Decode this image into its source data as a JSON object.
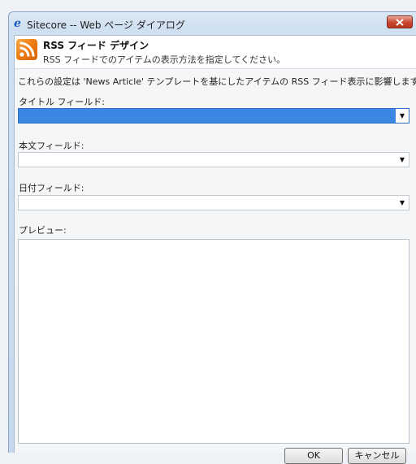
{
  "window": {
    "title": "Sitecore -- Web ページ ダイアログ",
    "close_label": "x"
  },
  "header": {
    "title": "RSS フィード デザイン",
    "subtitle": "RSS フィードでのアイテムの表示方法を指定してください。"
  },
  "form": {
    "info": "これらの設定は 'News Article' テンプレートを基にしたアイテムの RSS フィード表示に影響します。",
    "title_field_label": "タイトル フィールド:",
    "title_field_value": "",
    "body_field_label": "本文フィールド:",
    "body_field_value": "",
    "date_field_label": "日付フィールド:",
    "date_field_value": "",
    "preview_label": "プレビュー:"
  },
  "buttons": {
    "ok": "OK",
    "cancel": "キャンセル"
  },
  "colors": {
    "selected_field": "#3d87e4",
    "rss_icon": "#ec7b11",
    "close_button": "#c9452e"
  }
}
